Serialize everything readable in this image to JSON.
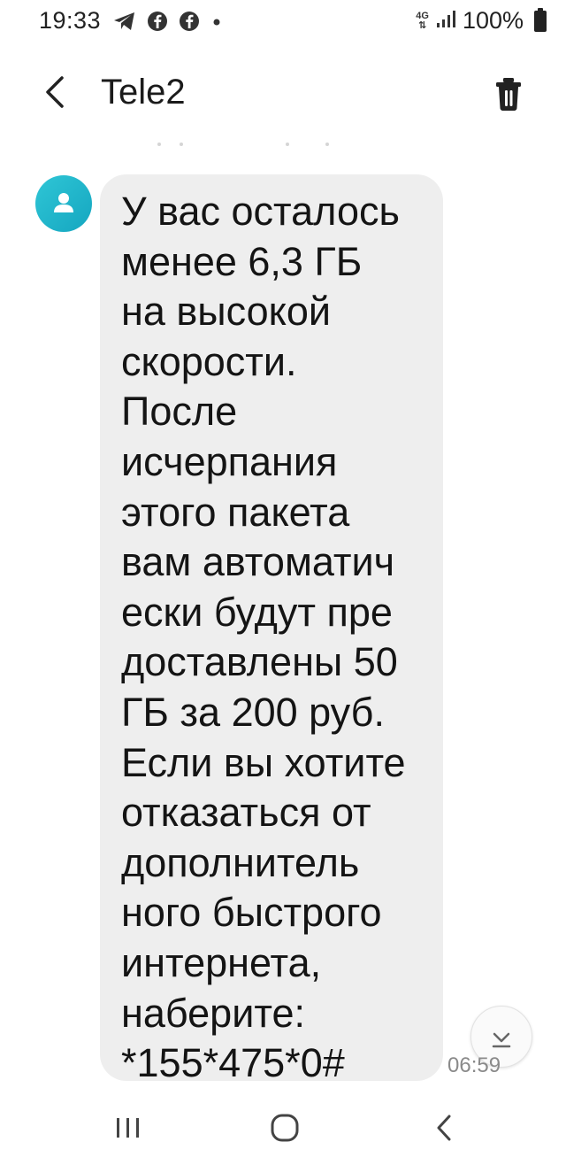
{
  "status_bar": {
    "time": "19:33",
    "network": "4G",
    "battery": "100%",
    "icons": [
      "telegram-icon",
      "facebook-icon",
      "facebook-icon",
      "notification-dot"
    ]
  },
  "header": {
    "title": "Tele2",
    "back_icon": "back-arrow-icon",
    "delete_icon": "trash-icon"
  },
  "message": {
    "lines": [
      "У вас осталось",
      "менее 6,3 ГБ",
      "на высокой",
      "скорости.",
      "После",
      "исчерпания",
      "этого пакета",
      "вам автоматич",
      "ески будут пре",
      "доставлены 50",
      "ГБ за 200 руб.",
      "Если вы хотите",
      "отказаться от",
      "дополнитель",
      "ного быстрого",
      "интернета,",
      "наберите:",
      "*155*475*0#"
    ],
    "time": "06:59"
  },
  "navigation": {
    "recent_icon": "recent-apps-icon",
    "home_icon": "home-icon",
    "back_icon": "nav-back-icon"
  },
  "colors": {
    "bubble": "#eeeeee",
    "avatar": "#1fb3c9",
    "background": "#ffffff"
  }
}
